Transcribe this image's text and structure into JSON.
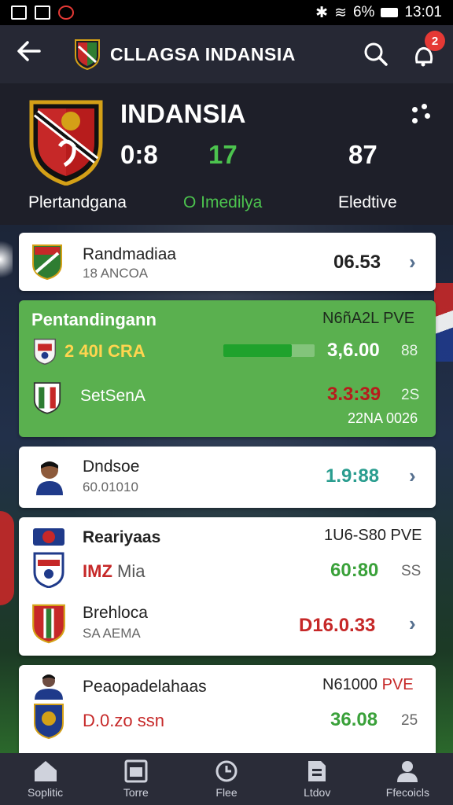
{
  "status_bar": {
    "battery": "6%",
    "time": "13:01"
  },
  "app_bar": {
    "title": "CLLAGSA INDANSIA",
    "notification_count": "2"
  },
  "team": {
    "name": "INDANSIA",
    "stat_a": "0:8",
    "stat_b": "17",
    "stat_c": "87",
    "tabs": [
      "Plertandgana",
      "O Imedilya",
      "Eledtive"
    ]
  },
  "cards": [
    {
      "name": "Randmadiaa",
      "sub": "18 ANCOA",
      "value": "06.53"
    },
    {
      "header": "Pentandingann",
      "header_right": "N6ñA2L PVE",
      "row1_label": "2 40I CRA",
      "row1_value": "3,6.00",
      "row1_extra": "88",
      "row1_progress": 0.75,
      "row2_label": "SetSenA",
      "row2_value": "3.3:39",
      "row2_extra": "2S",
      "row2_sub": "22NA 0026"
    },
    {
      "name": "Dndsoe",
      "sub": "60.01010",
      "value": "1.9:88"
    },
    {
      "header": "Reariyaas",
      "header_right": "1U6-S80 PVE",
      "row1_label_red": "IMZ",
      "row1_label": "Mia",
      "row1_value": "60:80",
      "row1_extra": "SS",
      "row2_name": "Brehloca",
      "row2_sub": "SA AEMA",
      "row2_value": "D16.0.33"
    },
    {
      "name": "Peaopadelahaas",
      "header_right_black": "N61000",
      "header_right_red": "PVE",
      "row1_label": "D.0.zo ssn",
      "row1_value": "36.08",
      "row1_extra": "25"
    }
  ],
  "bottom_nav": [
    "Soplitic",
    "Torre",
    "Flee",
    "Ltdov",
    "Ffecoicls"
  ],
  "colors": {
    "accent_green": "#4cc34e",
    "card_green": "#5ab04f",
    "value_red": "#c62828",
    "value_teal": "#2a9d8f",
    "value_green": "#3aa13a"
  }
}
